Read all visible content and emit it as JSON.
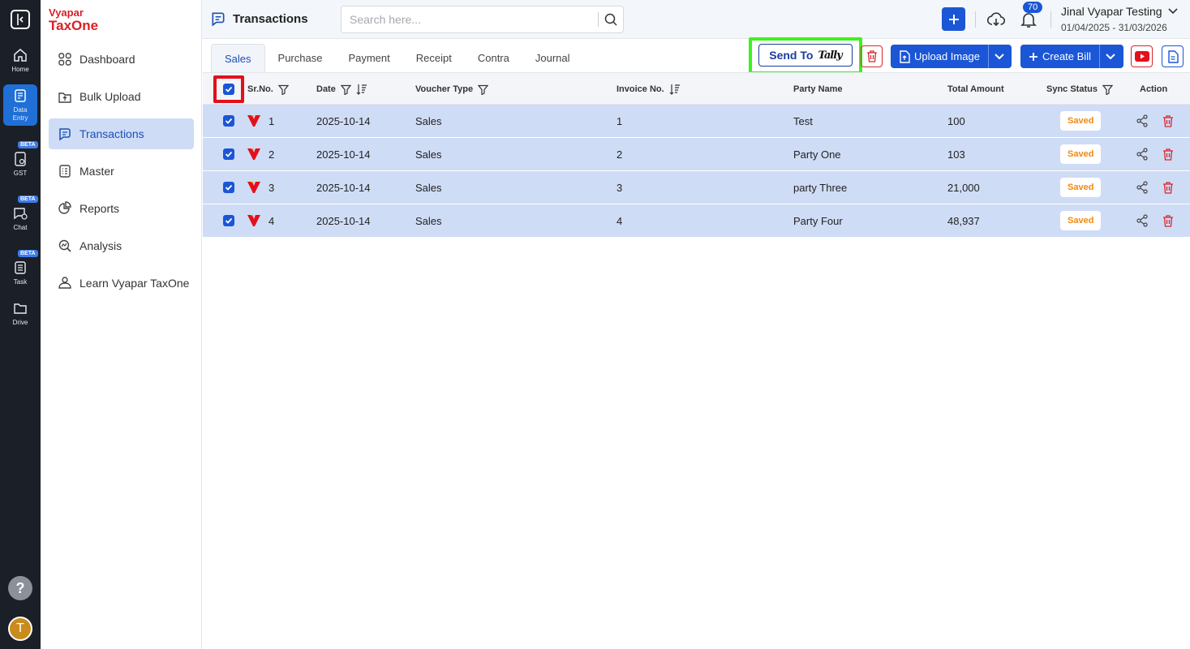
{
  "rail": {
    "items": [
      {
        "label": "Home",
        "icon": "home-icon"
      },
      {
        "label": "Data Entry",
        "icon": "data-entry-icon"
      },
      {
        "label": "GST",
        "icon": "gst-icon",
        "badge": "BETA"
      },
      {
        "label": "Chat",
        "icon": "chat-icon",
        "badge": "BETA"
      },
      {
        "label": "Task",
        "icon": "task-icon",
        "badge": "BETA"
      },
      {
        "label": "Drive",
        "icon": "folder-icon"
      }
    ],
    "help": "?",
    "avatar": "T"
  },
  "brand": {
    "line1": "Vyapar",
    "line2": "TaxOne"
  },
  "sidebar": {
    "items": [
      {
        "label": "Dashboard"
      },
      {
        "label": "Bulk Upload"
      },
      {
        "label": "Transactions"
      },
      {
        "label": "Master"
      },
      {
        "label": "Reports"
      },
      {
        "label": "Analysis"
      },
      {
        "label": "Learn Vyapar TaxOne"
      }
    ]
  },
  "header": {
    "title": "Transactions",
    "search_placeholder": "Search here...",
    "notifications": "70",
    "user_name": "Jinal Vyapar Testing",
    "user_dates": "01/04/2025 - 31/03/2026"
  },
  "tabs": [
    "Sales",
    "Purchase",
    "Payment",
    "Receipt",
    "Contra",
    "Journal"
  ],
  "toolbar": {
    "send_to": "Send To",
    "tally": "Tally",
    "upload_image": "Upload Image",
    "create_bill": "Create Bill"
  },
  "table": {
    "headers": {
      "srno": "Sr.No.",
      "date": "Date",
      "voucher": "Voucher Type",
      "invoice": "Invoice No.",
      "party": "Party Name",
      "amount": "Total Amount",
      "sync": "Sync Status",
      "action": "Action"
    },
    "rows": [
      {
        "srno": "1",
        "date": "2025-10-14",
        "voucher": "Sales",
        "invoice": "1",
        "party": "Test",
        "amount": "100",
        "status": "Saved"
      },
      {
        "srno": "2",
        "date": "2025-10-14",
        "voucher": "Sales",
        "invoice": "2",
        "party": "Party One",
        "amount": "103",
        "status": "Saved"
      },
      {
        "srno": "3",
        "date": "2025-10-14",
        "voucher": "Sales",
        "invoice": "3",
        "party": "party Three",
        "amount": "21,000",
        "status": "Saved"
      },
      {
        "srno": "4",
        "date": "2025-10-14",
        "voucher": "Sales",
        "invoice": "4",
        "party": "Party Four",
        "amount": "48,937",
        "status": "Saved"
      }
    ]
  },
  "colors": {
    "accent": "#1a56d6",
    "row_selected": "#cfdcf6",
    "highlight_green": "#3df21f",
    "highlight_red": "#e3101c",
    "saved": "#f08a10"
  }
}
